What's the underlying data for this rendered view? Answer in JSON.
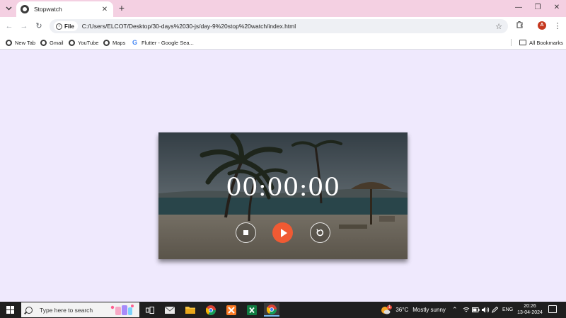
{
  "browser": {
    "tab": {
      "title": "Stopwatch",
      "close": "✕"
    },
    "new_tab": "+",
    "window_controls": {
      "minimize": "—",
      "restore": "❐",
      "close": "✕"
    },
    "nav": {
      "back": "←",
      "forward": "→",
      "reload": "↻"
    },
    "omnibox": {
      "chip_label": "File",
      "url": "C:/Users/ELCOT/Desktop/30-days%2030-js/day-9%20stop%20watch/index.html"
    },
    "profile_initial": "A",
    "bookmarks": [
      {
        "label": "New Tab",
        "icon": "globe-icon"
      },
      {
        "label": "Gmail",
        "icon": "globe-icon"
      },
      {
        "label": "YouTube",
        "icon": "globe-icon"
      },
      {
        "label": "Maps",
        "icon": "globe-icon"
      },
      {
        "label": "Flutter - Google Sea...",
        "icon": "google-icon"
      }
    ],
    "all_bookmarks": "All Bookmarks"
  },
  "stopwatch": {
    "time": "00:00:00",
    "buttons": [
      {
        "name": "stop",
        "icon": "stop-icon"
      },
      {
        "name": "play",
        "icon": "play-icon",
        "color": "#f05a33"
      },
      {
        "name": "reset",
        "icon": "reset-icon"
      }
    ]
  },
  "taskbar": {
    "search_placeholder": "Type here to search",
    "weather": {
      "temp": "36°C",
      "condition": "Mostly sunny",
      "badge": "1"
    },
    "language": "ENG",
    "clock": {
      "time": "20:26",
      "date": "13-04-2024"
    }
  },
  "colors": {
    "tabstrip": "#f4d0e2",
    "page_background": "#efe9fd",
    "accent": "#f05a33",
    "taskbar": "#1f1f1f"
  }
}
